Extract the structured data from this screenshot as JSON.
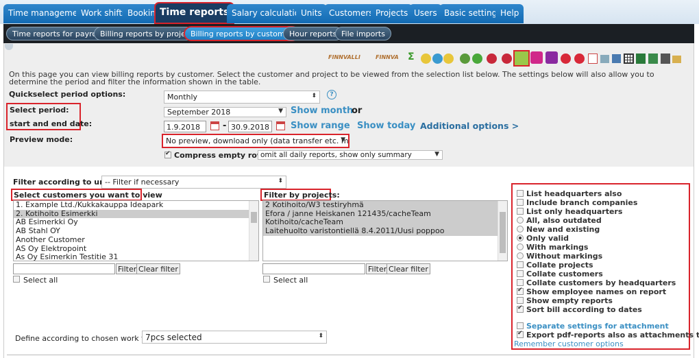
{
  "top_tabs": [
    "Time management",
    "Work shifts",
    "Booking",
    "Time reports",
    "Salary calculation",
    "Units",
    "Customers",
    "Projects",
    "Users",
    "Basic settings",
    "Help"
  ],
  "sub_tabs": [
    "Time reports for payroll",
    "Billing reports by project",
    "Billing reports by customer",
    "Hour reports",
    "File imports"
  ],
  "toolbar": {
    "brand1": "FINNVALLI",
    "brand2": "FINNVA",
    "sigma": "Σ"
  },
  "intro": "On this page you can view billing reports by customer. Select the customer and project to be viewed from the selection list below. The settings below will also allow you to determine the period and filter the information shown in the table.",
  "quickselect": {
    "label": "Quickselect period options:",
    "value": "Monthly",
    "help": "?"
  },
  "period": {
    "label": "Select period:",
    "dates_label": "start and end date:",
    "month_value": "September 2018",
    "show_month": "Show month",
    "or": "or",
    "start": "1.9.2018",
    "dash": "-",
    "end": "30.9.2018",
    "show_range": "Show range",
    "show_today": "Show today",
    "additional": "Additional options >"
  },
  "preview": {
    "label": "Preview mode:",
    "value": "No preview, download only (data transfer etc. mass"
  },
  "compress": {
    "label": "Compress empty rows:",
    "value": "omit all daily reports, show only summary"
  },
  "units_filter": {
    "label": "Filter according to units:",
    "value": "-- Filter if necessary"
  },
  "customers": {
    "label": "Select customers you want to view",
    "items": [
      "1. Example Ltd./Kukkakauppa Ideapark",
      "2. Kotihoito Esimerkki",
      "AB Esimerkki Oy",
      "AB Stahl OY",
      "Another Customer",
      "AS Oy Elektropoint",
      "As Oy Esimerkin Testitie 31"
    ],
    "selected_index": 1,
    "filter_btn": "Filter",
    "clear_btn": "Clear filter",
    "select_all": "Select all"
  },
  "projects": {
    "label": "Filter by projects:",
    "items": [
      "2 Kotihoito/W3 testiryhmä",
      "Efora / janne Heiskanen 121435/cacheTeam",
      "Kotihoito/cacheTeam",
      "Laitehuolto varistontiellä 8.4.2011/Uusi poppoo"
    ],
    "filter_btn": "Filter",
    "clear_btn": "Clear filter",
    "select_all": "Select all"
  },
  "worktask": {
    "label": "Define according to chosen work task:",
    "value": "7pcs selected"
  },
  "options": [
    {
      "label": "List headquarters also",
      "type": "checkbox",
      "checked": false
    },
    {
      "label": "Include branch companies",
      "type": "checkbox",
      "checked": false
    },
    {
      "label": "List only headquarters",
      "type": "checkbox",
      "checked": false
    },
    {
      "label": "All, also outdated",
      "type": "radio",
      "checked": false
    },
    {
      "label": "New and existing",
      "type": "radio",
      "checked": false
    },
    {
      "label": "Only valid",
      "type": "radio",
      "checked": true
    },
    {
      "label": "With markings",
      "type": "radio",
      "checked": false
    },
    {
      "label": "Without markings",
      "type": "radio",
      "checked": false
    },
    {
      "label": "Collate projects",
      "type": "checkbox",
      "checked": false
    },
    {
      "label": "Collate customers",
      "type": "checkbox",
      "checked": false
    },
    {
      "label": "Collate customers by headquarters",
      "type": "checkbox",
      "checked": false
    },
    {
      "label": "Show employee names on report",
      "type": "checkbox",
      "checked": true
    },
    {
      "label": "Show empty reports",
      "type": "checkbox",
      "checked": false
    },
    {
      "label": "Sort bill according to dates",
      "type": "checkbox",
      "checked": true
    }
  ],
  "separate_settings": "Separate settings for attachment",
  "export_pdf": "Export pdf-reports also as attachments to bill",
  "remember": "Remember customer options",
  "colors": {
    "tab_blue": "#1f78c1",
    "active_tab": "#1a3c62",
    "link": "#3a8fc3",
    "highlight": "#d9232b"
  }
}
